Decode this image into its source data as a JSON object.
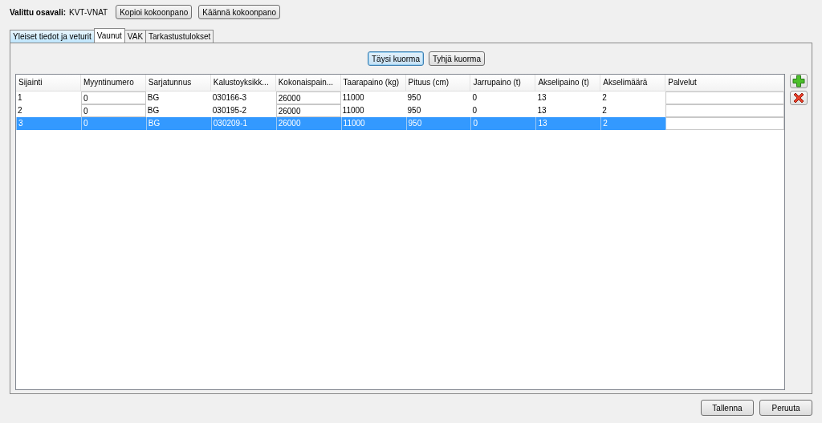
{
  "selection": {
    "label": "Valittu osavali:",
    "value": "KVT-VNAT"
  },
  "top_buttons": [
    "Kopioi kokoonpano",
    "Käännä kokoonpano"
  ],
  "tabs": [
    {
      "label": "Yleiset tiedot ja veturit",
      "selected": false
    },
    {
      "label": "Vaunut",
      "selected": true
    },
    {
      "label": "VAK",
      "selected": false
    },
    {
      "label": "Tarkastustulokset",
      "selected": false
    }
  ],
  "load_buttons": [
    {
      "label": "Täysi kuorma",
      "focused": true
    },
    {
      "label": "Tyhjä kuorma",
      "focused": false
    }
  ],
  "table": {
    "columns": [
      {
        "label": "Sijainti",
        "editable": false
      },
      {
        "label": "Myyntinumero",
        "editable": true
      },
      {
        "label": "Sarjatunnus",
        "editable": false
      },
      {
        "label": "Kalustoyksikk...",
        "editable": false
      },
      {
        "label": "Kokonaispain...",
        "editable": true
      },
      {
        "label": "Taarapaino (kg)",
        "editable": false
      },
      {
        "label": "Pituus (cm)",
        "editable": false
      },
      {
        "label": "Jarrupaino (t)",
        "editable": false
      },
      {
        "label": "Akselipaino (t)",
        "editable": false
      },
      {
        "label": "Akselimäärä",
        "editable": false
      },
      {
        "label": "Palvelut",
        "editable": true
      }
    ],
    "rows": [
      {
        "selected": false,
        "cells": [
          "1",
          "0",
          "BG",
          "030166-3",
          "26000",
          "11000",
          "950",
          "0",
          "13",
          "2",
          ""
        ]
      },
      {
        "selected": false,
        "cells": [
          "2",
          "0",
          "BG",
          "030195-2",
          "26000",
          "11000",
          "950",
          "0",
          "13",
          "2",
          ""
        ]
      },
      {
        "selected": true,
        "cells": [
          "3",
          "0",
          "BG",
          "030209-1",
          "26000",
          "11000",
          "950",
          "0",
          "13",
          "2",
          ""
        ]
      }
    ]
  },
  "bottom_buttons": [
    "Tallenna",
    "Peruuta"
  ]
}
